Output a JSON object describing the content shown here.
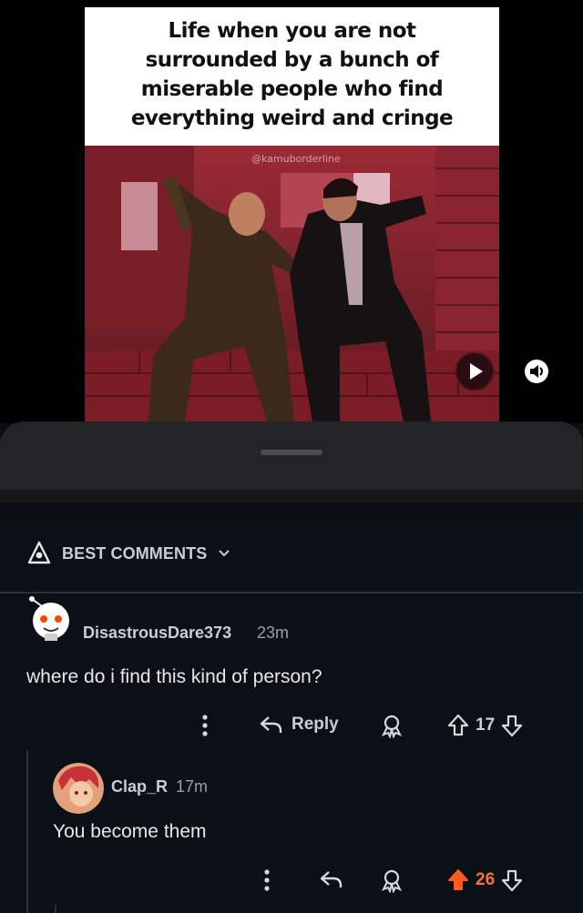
{
  "media": {
    "caption_lines": [
      "Life when you are not",
      "surrounded by a bunch of",
      "miserable people who find",
      "everything weird and cringe"
    ],
    "watermark": "@kamuborderline",
    "play_icon": "play-icon",
    "mute_icon": "volume-icon"
  },
  "comments": {
    "sort_label": "BEST COMMENTS",
    "sort_icon": "rocket-icon",
    "items": [
      {
        "author": "DisastrousDare373",
        "time": "23m",
        "body": "where do i find this kind of person?",
        "reply_label": "Reply",
        "score": "17",
        "upvoted": false
      },
      {
        "author": "Clap_R",
        "time": "17m",
        "body": "You become them",
        "score": "26",
        "upvoted": true
      }
    ]
  },
  "colors": {
    "upvote_active": "#ff5a1f",
    "background": "#0b1016",
    "sheet": "#222527"
  }
}
